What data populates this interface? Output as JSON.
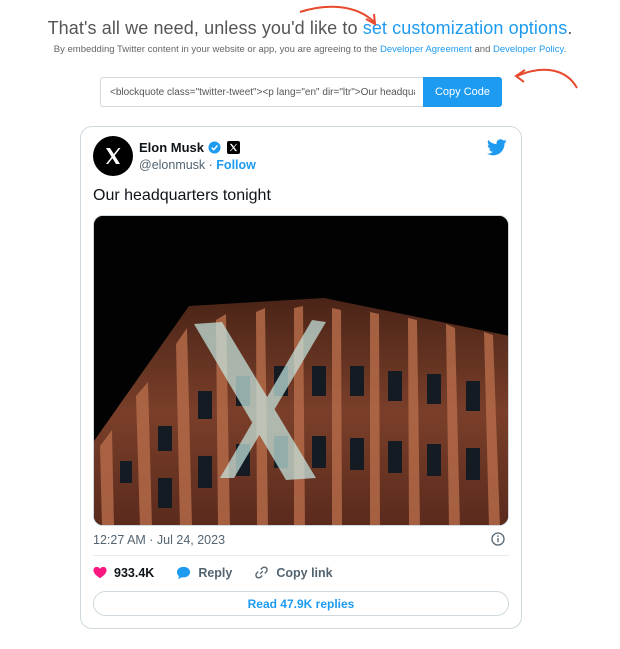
{
  "header": {
    "headline_prefix": "That's all we need, unless you'd like to ",
    "headline_link": "set customization options",
    "headline_suffix": ".",
    "terms_prefix": "By embedding Twitter content in your website or app, you are agreeing to the ",
    "terms_link_1": "Developer Agreement",
    "terms_and": " and ",
    "terms_link_2": "Developer Policy",
    "terms_suffix": "."
  },
  "embed": {
    "code_value": "<blockquote class=\"twitter-tweet\"><p lang=\"en\" dir=\"ltr\">Our headquarters tonight</p>",
    "copy_button": "Copy Code"
  },
  "tweet": {
    "display_name": "Elon Musk",
    "handle": "@elonmusk",
    "separator": " · ",
    "follow": "Follow",
    "text": "Our headquarters tonight",
    "timestamp": "12:27 AM · Jul 24, 2023",
    "likes": "933.4K",
    "reply_label": "Reply",
    "copy_link_label": "Copy link",
    "read_replies": "Read 47.9K replies"
  },
  "icons": {
    "verified": "verified-badge-icon",
    "affiliate": "x-logo-badge-icon",
    "brand": "twitter-bird-icon",
    "like": "heart-icon",
    "reply": "speech-bubble-icon",
    "copy": "link-icon",
    "info": "info-icon"
  },
  "colors": {
    "accent": "#1d9bf0",
    "heart": "#f91880",
    "annotation_arrow": "#e8492c",
    "muted_text": "#536471"
  }
}
